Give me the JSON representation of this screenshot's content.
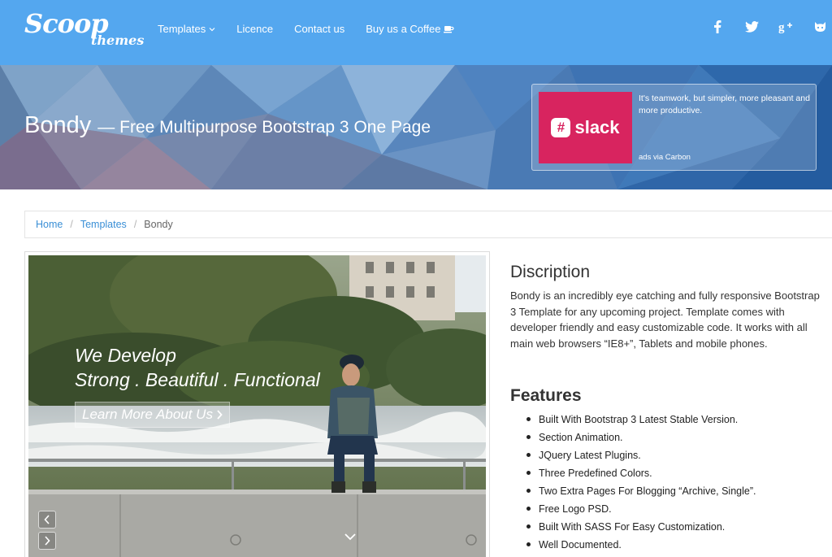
{
  "logo": {
    "main": "Scoop",
    "sub": "themes"
  },
  "nav": [
    {
      "label": "Templates",
      "icon": "chevron-down-icon"
    },
    {
      "label": "Licence"
    },
    {
      "label": "Contact us"
    },
    {
      "label": "Buy us a Coffee",
      "icon": "coffee-cup-icon"
    }
  ],
  "social": [
    "facebook-icon",
    "twitter-icon",
    "google-plus-icon",
    "github-icon"
  ],
  "hero": {
    "title": "Bondy",
    "subtitle": "— Free Multipurpose Bootstrap 3 One Page"
  },
  "ad": {
    "brand": "slack",
    "text": "It's teamwork, but simpler, more pleasant and more productive.",
    "via": "ads via Carbon"
  },
  "breadcrumb": {
    "items": [
      "Home",
      "Templates"
    ],
    "current": "Bondy",
    "separator": "/"
  },
  "preview": {
    "line1": "We Develop",
    "line2": "Strong .  Beautiful .  Functional",
    "button": "Learn More About Us"
  },
  "description": {
    "heading": "Discription",
    "text": "Bondy is an incredibly eye catching and fully responsive Bootstrap 3 Template for any upcoming project. Template comes with developer friendly and easy customizable code. It works with all main web browsers “IE8+”, Tablets and mobile phones."
  },
  "features": {
    "heading": "Features",
    "items": [
      "Built With Bootstrap 3 Latest Stable Version.",
      "Section Animation.",
      "JQuery Latest Plugins.",
      "Three Predefined Colors.",
      "Two Extra Pages For Blogging “Archive, Single”.",
      "Free Logo PSD.",
      "Built With SASS For Easy Customization.",
      "Well Documented."
    ]
  },
  "colors": {
    "navbar": "#54a7ef",
    "link": "#3a8fd6",
    "slack": "#d8245f"
  }
}
